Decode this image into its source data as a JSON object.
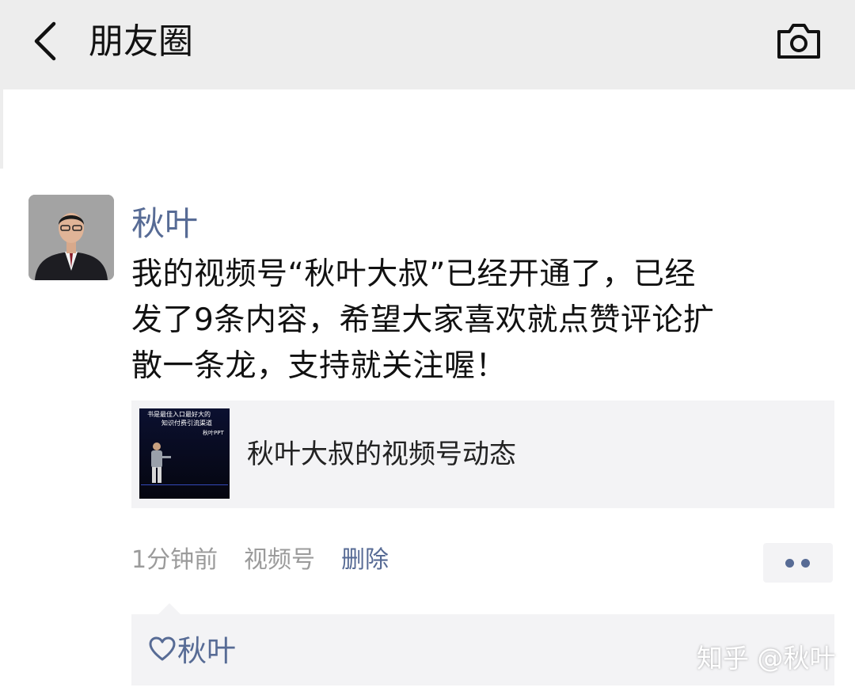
{
  "header": {
    "title": "朋友圈",
    "back_icon": "chevron-left-icon",
    "camera_icon": "camera-icon",
    "background": "#ededed"
  },
  "post": {
    "author": "秋叶",
    "text_lines": [
      "我的视频号“秋叶大叔”已经开通了，已经",
      "发了9条内容，希望大家喜欢就点赞评论扩",
      "散一条龙，支持就关注喔！"
    ],
    "link_card": {
      "title": "秋叶大叔的视频号动态",
      "thumb_caption_1": "书是最佳入口最好大的",
      "thumb_caption_2": "知识付费引流渠道",
      "thumb_caption_3": "秋叶PPT"
    },
    "time": "1分钟前",
    "source": "视频号",
    "delete_label": "删除",
    "more_icon": "more-dots-icon",
    "likes": {
      "heart_icon": "heart-icon",
      "names": "秋叶"
    }
  },
  "watermark": "知乎 @秋叶",
  "colors": {
    "link": "#576b95",
    "meta_gray": "#9b9b9b",
    "card_bg": "#f3f3f5"
  }
}
